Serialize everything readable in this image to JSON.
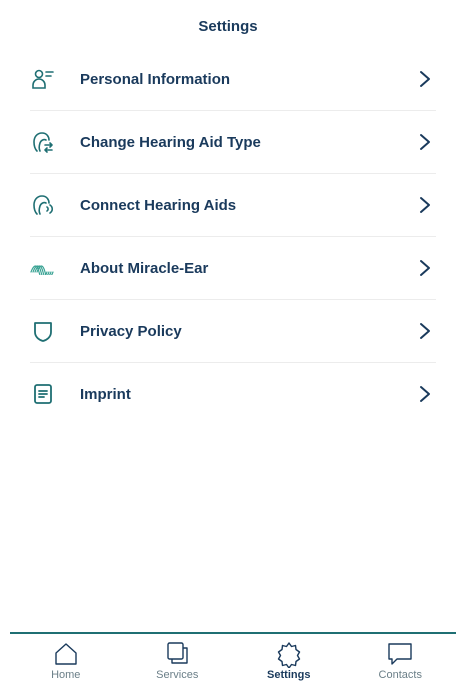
{
  "header": {
    "title": "Settings"
  },
  "colors": {
    "accent": "#1f6f73",
    "text": "#1a3a5c",
    "muted": "#6b7f88"
  },
  "menu": [
    {
      "label": "Personal Information",
      "icon": "person-icon"
    },
    {
      "label": "Change Hearing Aid Type",
      "icon": "hearing-aid-swap-icon"
    },
    {
      "label": "Connect Hearing Aids",
      "icon": "hearing-aid-connect-icon"
    },
    {
      "label": "About Miracle-Ear",
      "icon": "miracle-ear-logo-icon"
    },
    {
      "label": "Privacy Policy",
      "icon": "shield-icon"
    },
    {
      "label": "Imprint",
      "icon": "document-icon"
    }
  ],
  "tabs": [
    {
      "label": "Home",
      "icon": "home-icon",
      "active": false
    },
    {
      "label": "Services",
      "icon": "services-icon",
      "active": false
    },
    {
      "label": "Settings",
      "icon": "gear-icon",
      "active": true
    },
    {
      "label": "Contacts",
      "icon": "chat-icon",
      "active": false
    }
  ]
}
